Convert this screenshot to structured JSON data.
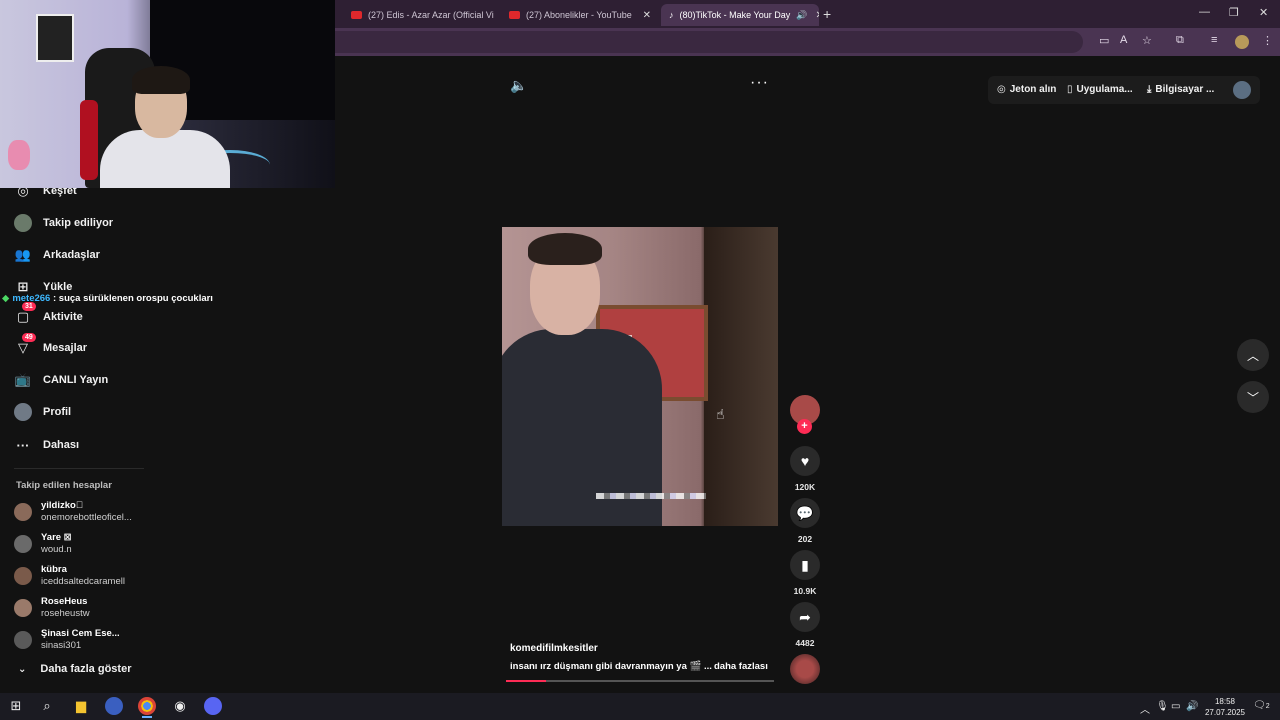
{
  "browser": {
    "tabs": [
      {
        "title": "(27) Edis - Azar Azar (Official Vi",
        "icon": "youtube-icon"
      },
      {
        "title": "(27) Abonelikler - YouTube",
        "icon": "youtube-icon"
      },
      {
        "title": "(80)TikTok - Make Your Day",
        "icon": "tiktok-icon",
        "active": true
      }
    ],
    "new_tab": "+",
    "window_controls": {
      "minimize": "—",
      "restore": "❐",
      "close": "✕"
    }
  },
  "sidebar": {
    "items": [
      {
        "label": "Keşfet",
        "icon": "compass-icon"
      },
      {
        "label": "Takip ediliyor",
        "icon": "following-avatar-icon"
      },
      {
        "label": "Arkadaşlar",
        "icon": "friends-icon"
      },
      {
        "label": "Yükle",
        "icon": "upload-icon"
      },
      {
        "label": "Aktivite",
        "icon": "activity-icon",
        "badge": "31"
      },
      {
        "label": "Mesajlar",
        "icon": "messages-icon",
        "badge": "49"
      },
      {
        "label": "CANLI Yayın",
        "icon": "live-icon"
      },
      {
        "label": "Profil",
        "icon": "profile-avatar-icon"
      },
      {
        "label": "Dahası",
        "icon": "more-icon"
      }
    ],
    "following_title": "Takip edilen hesaplar",
    "accounts": [
      {
        "name": "yildizko\u0000",
        "handle": "onemorebottleoficel...",
        "color": "#8a6a5a"
      },
      {
        "name": "Yare ⊠",
        "handle": "woud.n",
        "color": "#6a6a6a"
      },
      {
        "name": "kübra",
        "handle": "iceddsaltedcaramell",
        "color": "#7a5a4a"
      },
      {
        "name": "RoseHeus",
        "handle": "roseheustw",
        "color": "#9a7a6a"
      },
      {
        "name": "Şinasi  Cem  Ese...",
        "handle": "sinasi301",
        "color": "#5a5a5a"
      }
    ],
    "see_more": "Daha fazla göster"
  },
  "chat_overlay": {
    "user": "mete266",
    "message": " : suça sürüklenen orospu çocukları"
  },
  "header": {
    "coins": "Jeton alın",
    "app": "Uygulama...",
    "desktop": "Bilgisayar ..."
  },
  "video": {
    "author": "komedifilmkesitler",
    "caption": "insanı ırz düşmanı gibi davranmayın ya 🎬 ...",
    "see_more": "daha fazlası",
    "progress": 0.15,
    "likes": "120K",
    "comments": "202",
    "saves": "10.9K",
    "shares": "4482"
  },
  "taskbar": {
    "time": "18:58",
    "date": "27.07.2025",
    "notifications": "2"
  }
}
